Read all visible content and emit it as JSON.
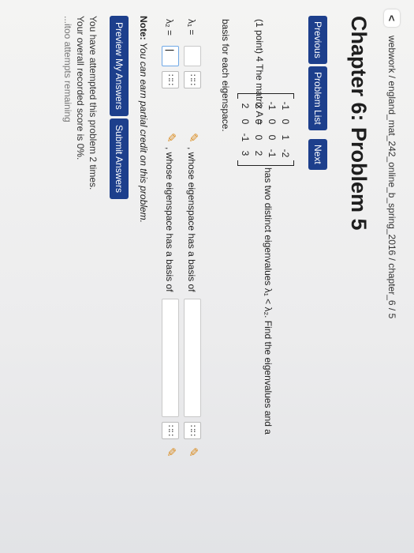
{
  "header": {
    "back_symbol": "<",
    "breadcrumb": "webwork / england_mat_242_online_b_spring_2016 / chapter_6 / 5"
  },
  "title": "Chapter 6: Problem 5",
  "nav": {
    "previous": "Previous",
    "problem_list": "Problem List",
    "next": "Next"
  },
  "problem": {
    "intro": "(1 point) 4 The matrix A =",
    "matrix": [
      [
        "-1",
        "0",
        "1",
        "-2"
      ],
      [
        "-1",
        "0",
        "0",
        "-1"
      ],
      [
        "2",
        "0",
        "0",
        "2"
      ],
      [
        "2",
        "0",
        "-1",
        "3"
      ]
    ],
    "after_matrix": "has two distinct eigenvalues λ₁ < λ₂. Find the eigenvalues and a",
    "basis_line": "basis for each eigenspace.",
    "lambda1_label": "λ₁ =",
    "lambda2_label": "λ₂ =",
    "lambda2_value": "|",
    "eigenspace_text": ", whose eigenspace has a basis of",
    "grid_symbol": "∷∷",
    "pencil_symbol": "✎"
  },
  "note": {
    "label": "Note:",
    "text": "You can earn partial credit on this problem."
  },
  "actions": {
    "preview": "Preview My Answers",
    "submit": "Submit Answers"
  },
  "status": {
    "attempts": "You have attempted this problem 2 times.",
    "score": "Your overall recorded score is 0%.",
    "remaining": "...itoo attempts remaining"
  }
}
